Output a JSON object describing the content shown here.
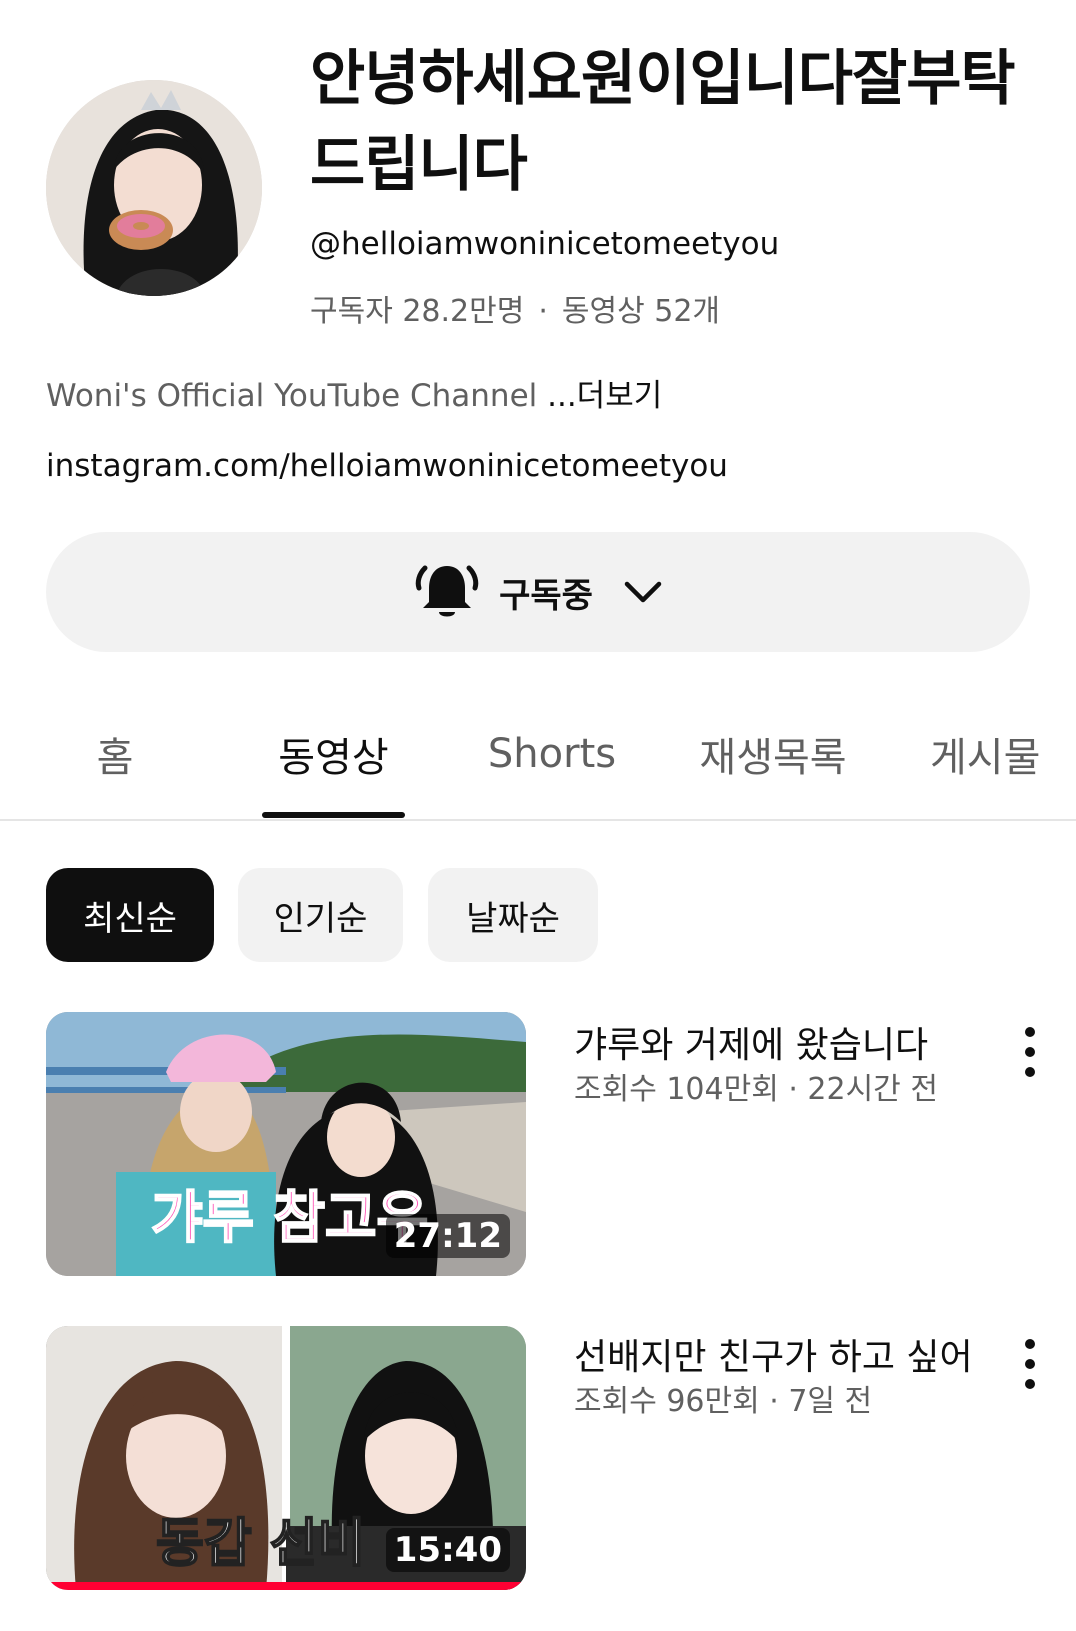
{
  "channel": {
    "name": "안녕하세요원이입니다잘부탁드립니다",
    "handle": "@helloiamwoninicetomeetyou",
    "subscribers": "구독자 28.2만명",
    "video_count": "동영상 52개",
    "stats_separator": "·",
    "description": "Woni's Official YouTube Channel ",
    "more_label": "...더보기",
    "link": "instagram.com/helloiamwoninicetomeetyou"
  },
  "subscribe": {
    "label": "구독중",
    "icon": "bell-icon"
  },
  "tabs": [
    {
      "label": "홈",
      "active": false
    },
    {
      "label": "동영상",
      "active": true
    },
    {
      "label": "Shorts",
      "active": false
    },
    {
      "label": "재생목록",
      "active": false
    },
    {
      "label": "게시물",
      "active": false
    }
  ],
  "chips": [
    {
      "label": "최신순",
      "selected": true
    },
    {
      "label": "인기순",
      "selected": false
    },
    {
      "label": "날짜순",
      "selected": false
    }
  ],
  "videos": [
    {
      "title": "갸루와 거제에 왔습니다",
      "meta": "조회수 104만회 · 22시간 전",
      "duration": "27:12",
      "thumb_caption": "갸루 참고우",
      "watched_progress": 0
    },
    {
      "title": "선배지만 친구가 하고 싶어",
      "meta": "조회수 96만회 · 7일 전",
      "duration": "15:40",
      "thumb_caption": "동갑 선비",
      "watched_progress": 1.0
    }
  ],
  "colors": {
    "text_primary": "#0f0f0f",
    "text_secondary": "#606060",
    "chip_bg": "#f2f2f2",
    "progress": "#ff0033"
  }
}
